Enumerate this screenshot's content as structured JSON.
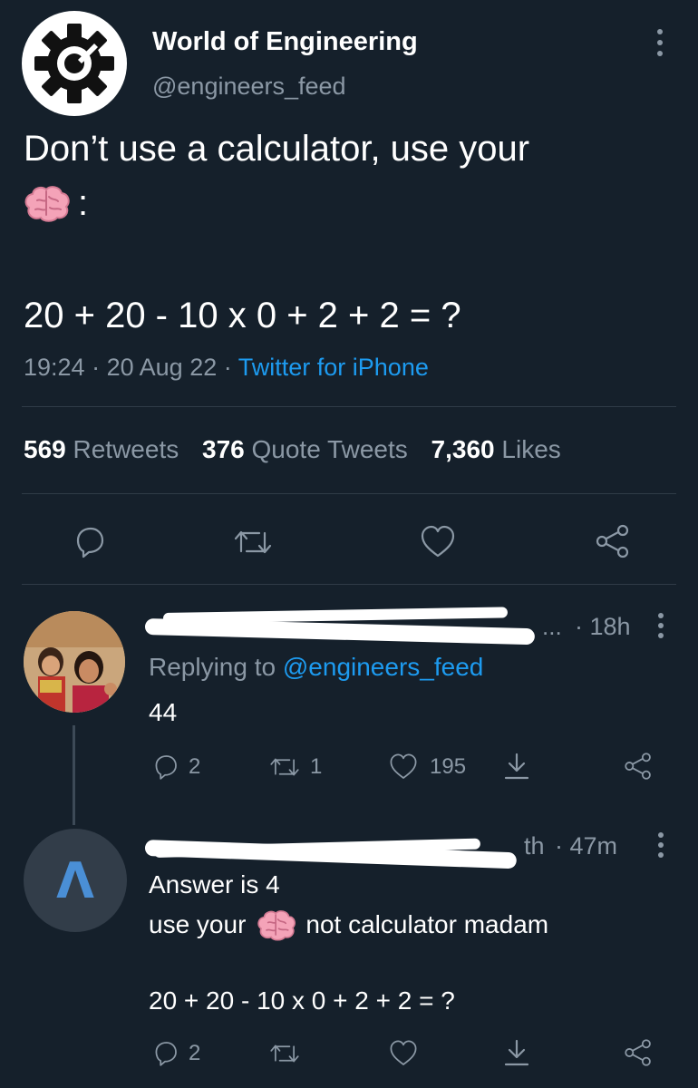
{
  "tweet": {
    "author_name": "World of Engineering",
    "author_handle": "@engineers_feed",
    "text_line1": "Don’t use a calculator, use your",
    "text_line2_suffix": ":",
    "equation": "20 + 20 - 10 x 0 + 2 + 2 = ?",
    "time": "19:24",
    "date": "20 Aug 22",
    "sep": "·",
    "source": "Twitter for iPhone",
    "stats": {
      "retweets_count": "569",
      "retweets_label": "Retweets",
      "quotes_count": "376",
      "quotes_label": "Quote Tweets",
      "likes_count": "7,360",
      "likes_label": "Likes"
    }
  },
  "reply1": {
    "name_fragment": "...",
    "time": "· 18h",
    "replying_prefix": "Replying to",
    "replying_handle": "@engineers_feed",
    "text": "44",
    "reply_count": "2",
    "retweet_count": "1",
    "like_count": "195"
  },
  "reply2": {
    "avatar_letter": "Λ",
    "name_fragment": "th",
    "time": "· 47m",
    "text_line1": "Answer is 4",
    "text_line2_prefix": "use your",
    "text_line2_suffix": "not calculator madam",
    "equation": "20 + 20 - 10 x 0 + 2 + 2 = ?",
    "reply_count": "2"
  },
  "colors": {
    "background": "#15202b",
    "accent": "#1d9bf0",
    "muted": "#8b98a5",
    "text": "#ffffff"
  },
  "icons": [
    "gear-logo-icon",
    "brain-emoji-icon",
    "more-options-icon",
    "reply-icon",
    "retweet-icon",
    "like-icon",
    "share-icon"
  ]
}
